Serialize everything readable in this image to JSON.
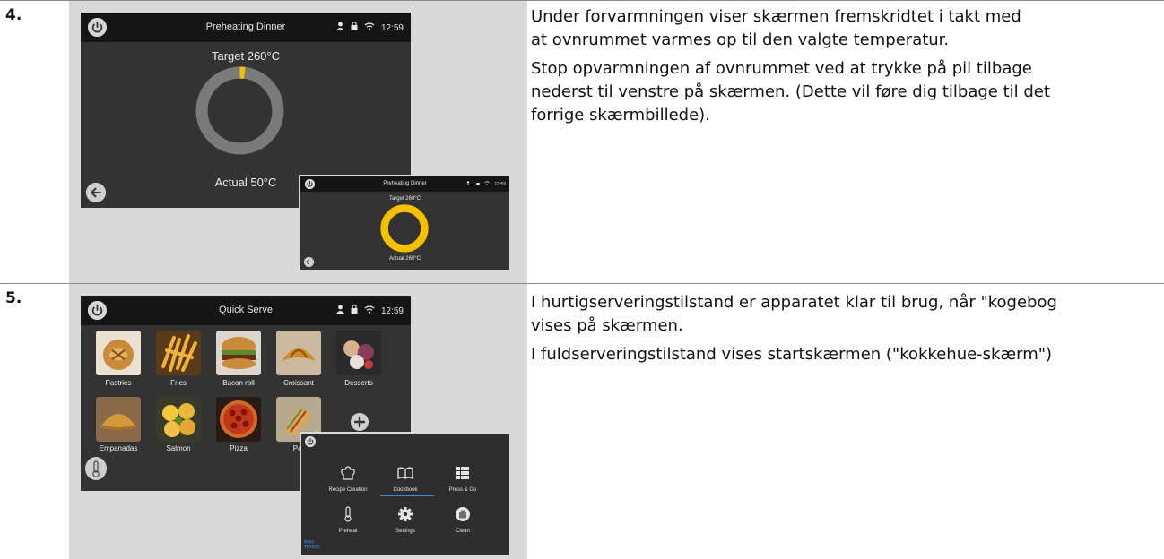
{
  "step4": {
    "number": "4.",
    "main_screen": {
      "title": "Preheating Dinner",
      "time": "12:59",
      "target": "Target 260°C",
      "actual": "Actual 50°C",
      "progress": 0.02
    },
    "inset_screen": {
      "title": "Preheating Dinner",
      "time": "12:59",
      "target": "Target 260°C",
      "actual": "Actual 260°C",
      "progress": 1.0
    },
    "paragraphs": [
      "Under forvarmningen viser skærmen fremskridtet i takt med",
      "at ovnrummet varmes op til den valgte temperatur.",
      "Stop opvarmningen af ovnrummet ved at trykke på pil tilbage",
      "nederst til venstre på skærmen. (Dette vil føre dig tilbage til det",
      "forrige skærmbillede)."
    ]
  },
  "step5": {
    "number": "5.",
    "quick_screen": {
      "title": "Quick Serve",
      "time": "12:59",
      "items": [
        "Pastries",
        "Fries",
        "Bacon roll",
        "Croissant",
        "Desserts",
        "Empanadas",
        "Salmon",
        "Pizza",
        "Par"
      ]
    },
    "menu_screen": {
      "items": [
        "Recipe Creation",
        "Cookbook",
        "Press & Go",
        "Preheat",
        "Settings",
        "Clean"
      ],
      "brand_top": "easy",
      "brand_bottom": "TOUCH"
    },
    "paragraphs": [
      "I hurtigserveringstilstand er apparatet klar til brug, når \"kogebog",
      "vises på skærmen.",
      "I fuldserveringstilstand vises startskærmen (\"kokkehue-skærm\")"
    ]
  },
  "colors": {
    "accent": "#f5c000",
    "ring_gray": "#7a7a7a",
    "screen_bg": "#333333",
    "bar_bg": "#151515"
  }
}
